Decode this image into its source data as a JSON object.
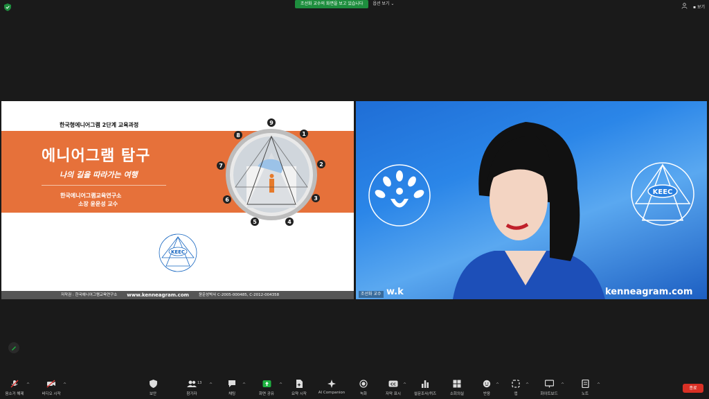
{
  "topbar": {
    "share_banner": "조선화 교수의 화면을 보고 있습니다",
    "view_options": "옵션 보기",
    "view_toggle": "보기"
  },
  "slide": {
    "course": "한국형에니어그램 2단계 교육과정",
    "title": "에니어그램 탐구",
    "subtitle": "나의 길을 따라가는 여행",
    "institute": "한국에니어그램교육연구소",
    "professor": "소장 윤운성 교수",
    "enneagram_numbers": [
      "9",
      "1",
      "2",
      "3",
      "4",
      "5",
      "6",
      "7",
      "8"
    ],
    "logo_text": "KEEC",
    "logo_ring_text": "한국에니어그램교육연구소",
    "footer_copyright": "저작권 : 한국에니어그램교육연구소",
    "footer_url": "www.kenneagram.com",
    "footer_reg": "윤운성박사 C-2005-000485, C-2012-004358"
  },
  "camera": {
    "participant_name": "조선화 교수",
    "backdrop_logo_left_ring": "(사)한국에니어그램인성연구원",
    "backdrop_logo_right": "KEEC",
    "backdrop_logo_right_ring": "한국에니어그램교육연구소",
    "backdrop_url": "kenneagram.com",
    "backdrop_url_partial": "w.k"
  },
  "toolbar": {
    "mute": "음소거 해제",
    "video": "비디오 시작",
    "security": "보안",
    "participants": "참가자",
    "participants_count": "13",
    "chat": "채팅",
    "share": "화면 공유",
    "summary": "요약 시작",
    "ai_companion": "AI Companion",
    "record": "녹화",
    "captions": "자막 표시",
    "polls": "설문조사/퀴즈",
    "breakout": "소회의실",
    "reactions": "반응",
    "apps": "앱",
    "whiteboard": "화이트보드",
    "notes": "노트",
    "end": "종료"
  },
  "colors": {
    "slide_orange": "#e6713a",
    "share_green": "#1e8e3e",
    "end_red": "#d93025",
    "share_button_green": "#1fb141"
  }
}
